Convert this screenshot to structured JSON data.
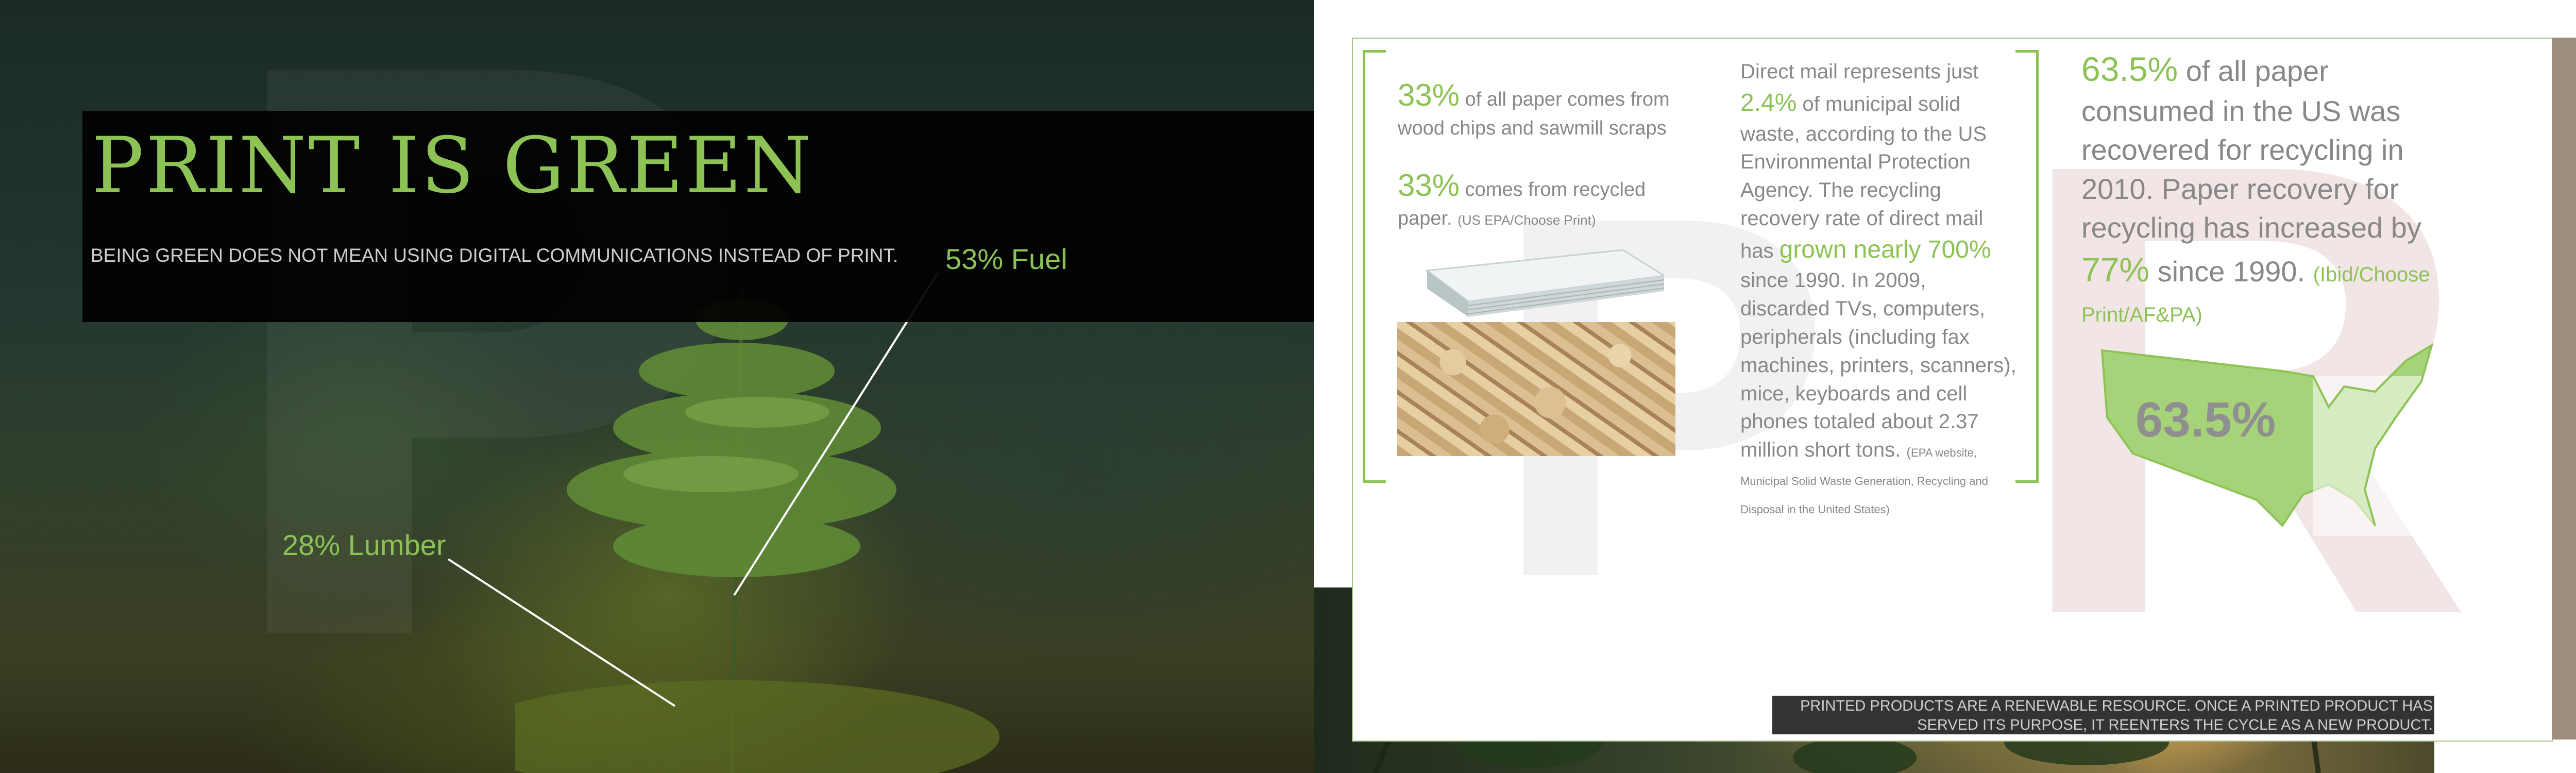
{
  "left": {
    "title": "PRINT IS GREEN",
    "subtitle": "BEING GREEN DOES NOT MEAN USING DIGITAL COMMUNICATIONS INSTEAD OF PRINT.",
    "fuel_label": "53% Fuel",
    "lumber_label": "28% Lumber"
  },
  "right": {
    "col1": {
      "p1_pct": "33%",
      "p1_text": " of all paper comes from wood chips and sawmill scraps",
      "p2_pct": "33%",
      "p2_text": " comes from recycled paper. ",
      "p2_source": "(US EPA/Choose Print)"
    },
    "col2": {
      "t1": "Direct mail represents just ",
      "h1": "2.4%",
      "t2": " of municipal solid waste, according to the US Environmental Protection Agency. The recycling recovery rate of direct mail has ",
      "h2": "grown nearly 700%",
      "t3": " since 1990. In 2009, discarded TVs, computers, peripherals (including fax machines, printers, scanners), mice, keyboards and cell phones totaled about 2.37 million short tons. ",
      "s1": "(",
      "s2": "EPA website, Municipal Solid Waste Generation, Recycling and Disposal in the United States)"
    },
    "col3": {
      "h1": "63.5%",
      "t1": " of all paper consumed in the US was recovered for recycling in 2010. Paper recovery for recycling has increased by ",
      "h2": "77%",
      "t2": " since 1990. ",
      "source": "(Ibid/Choose Print/AF&PA)",
      "map_value": "63.5%"
    },
    "caption": "PRINTED PRODUCTS ARE A RENEWABLE RESOURCE. ONCE A PRINTED PRODUCT HAS SERVED ITS PURPOSE, IT REENTERS THE CYCLE AS A NEW PRODUCT."
  },
  "colors": {
    "accent_green": "#8dc355",
    "body_gray": "#888888",
    "brown_bar": "#9e8c7c"
  },
  "icons": [
    "sapling-image",
    "paper-stack-image",
    "wood-chips-image",
    "us-map-shape"
  ]
}
